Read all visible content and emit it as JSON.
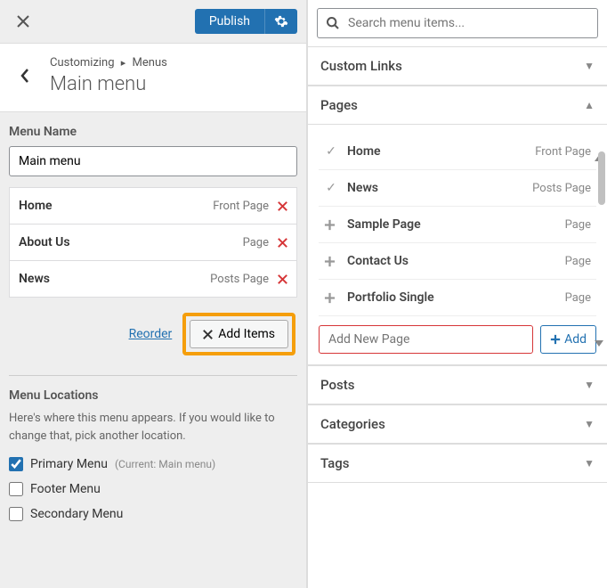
{
  "topbar": {
    "publish_label": "Publish"
  },
  "breadcrumb": {
    "prefix": "Customizing",
    "section": "Menus",
    "title": "Main menu"
  },
  "menu": {
    "name_label": "Menu Name",
    "name_value": "Main menu",
    "items": [
      {
        "label": "Home",
        "type": "Front Page"
      },
      {
        "label": "About Us",
        "type": "Page"
      },
      {
        "label": "News",
        "type": "Posts Page"
      }
    ],
    "reorder_label": "Reorder",
    "add_items_label": "Add Items"
  },
  "locations": {
    "heading": "Menu Locations",
    "description": "Here's where this menu appears. If you would like to change that, pick another location.",
    "options": [
      {
        "label": "Primary Menu",
        "sub": "(Current: Main menu)",
        "checked": true
      },
      {
        "label": "Footer Menu",
        "sub": "",
        "checked": false
      },
      {
        "label": "Secondary Menu",
        "sub": "",
        "checked": false
      }
    ]
  },
  "search": {
    "placeholder": "Search menu items..."
  },
  "sections": {
    "custom_links": "Custom Links",
    "pages": "Pages",
    "posts": "Posts",
    "categories": "Categories",
    "tags": "Tags"
  },
  "pages": {
    "items": [
      {
        "title": "Home",
        "type": "Front Page",
        "added": true
      },
      {
        "title": "News",
        "type": "Posts Page",
        "added": true
      },
      {
        "title": "Sample Page",
        "type": "Page",
        "added": false
      },
      {
        "title": "Contact Us",
        "type": "Page",
        "added": false
      },
      {
        "title": "Portfolio Single",
        "type": "Page",
        "added": false
      }
    ],
    "add_new_placeholder": "Add New Page",
    "add_button_label": "Add"
  }
}
